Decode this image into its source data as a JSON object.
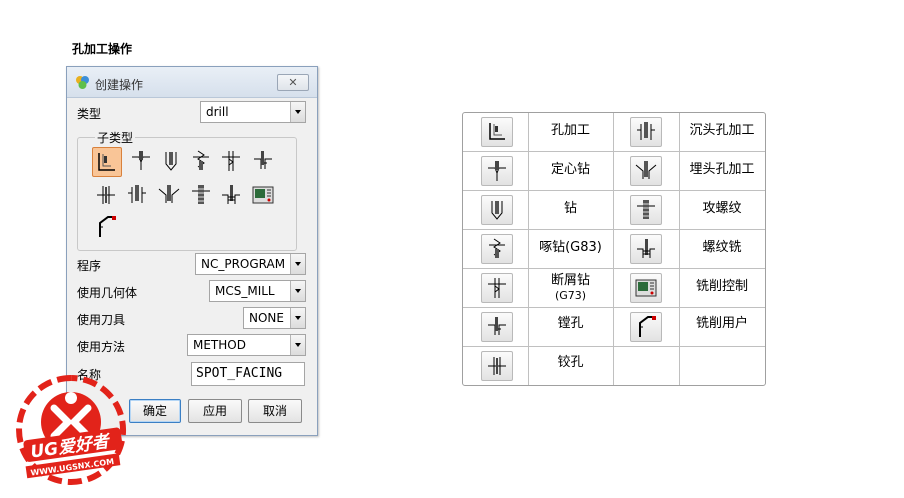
{
  "page_title": "孔加工操作",
  "dialog": {
    "title": "创建操作",
    "close_icon": "close-x-icon",
    "type_label": "类型",
    "type_value": "drill",
    "subtype_label": "子类型",
    "subtype_icons": [
      "spot-facing-icon",
      "spot-drilling-icon",
      "drilling-icon",
      "peck-drilling-icon",
      "breakchip-drilling-icon",
      "boring-icon",
      "reaming-icon",
      "counterboring-icon",
      "countersinking-icon",
      "tapping-icon",
      "thread-milling-icon",
      "mill-control-icon",
      "mill-user-icon"
    ],
    "program_label": "程序",
    "program_value": "NC_PROGRAM",
    "geometry_label": "使用几何体",
    "geometry_value": "MCS_MILL",
    "tool_label": "使用刀具",
    "tool_value": "NONE",
    "method_label": "使用方法",
    "method_value": "METHOD",
    "name_label": "名称",
    "name_value": "SPOT_FACING",
    "ok_label": "确定",
    "apply_label": "应用",
    "cancel_label": "取消"
  },
  "reference_table": {
    "rows": [
      {
        "left": "孔加工",
        "right": "沉头孔加工"
      },
      {
        "left": "定心钻",
        "right": "埋头孔加工"
      },
      {
        "left": "钻",
        "right": "攻螺纹"
      },
      {
        "left": "啄钻(G83)",
        "right": "螺纹铣"
      },
      {
        "left": "断屑钻",
        "left_sub": "(G73)",
        "right": "铣削控制"
      },
      {
        "left": "镗孔",
        "right": "铣削用户"
      },
      {
        "left": "铰孔",
        "right": ""
      }
    ]
  },
  "logo": {
    "text": "UG爱好者",
    "url": "WWW.UGSNX.COM",
    "color": "#e2231a"
  }
}
